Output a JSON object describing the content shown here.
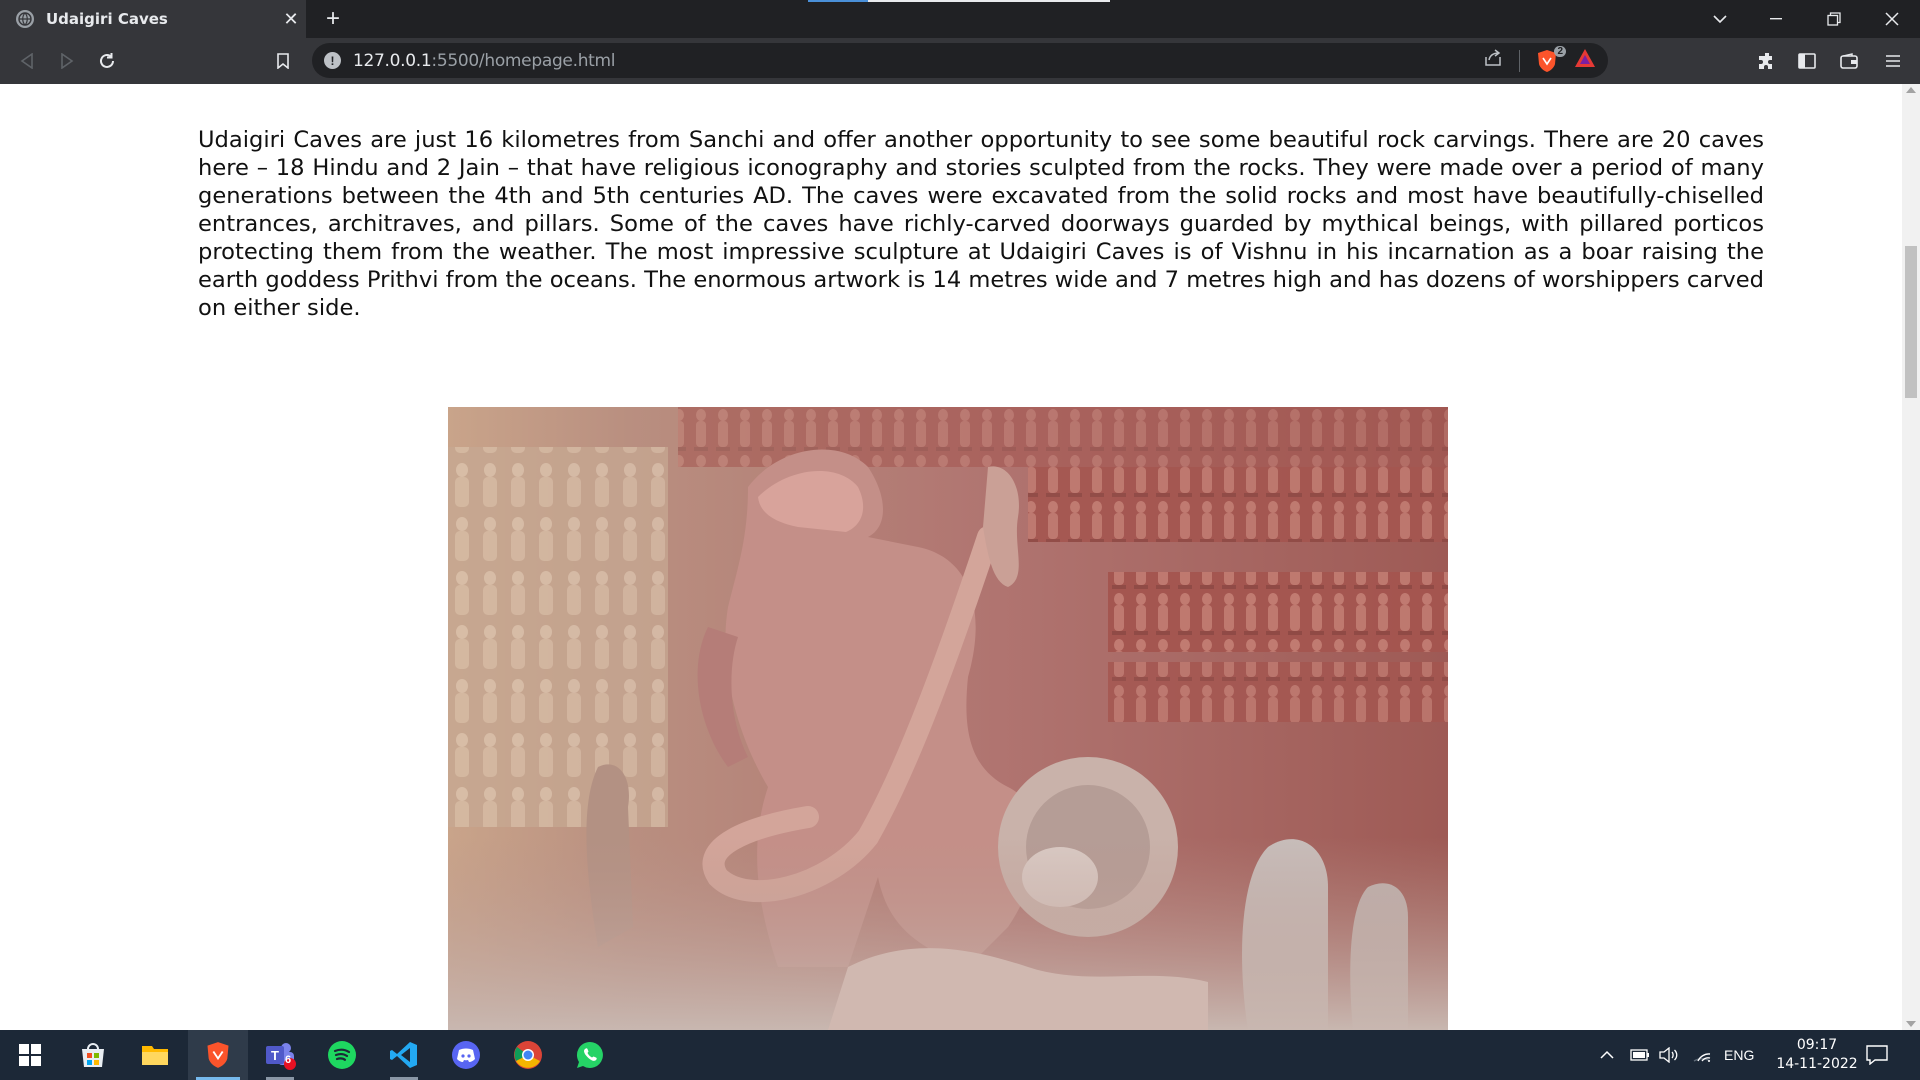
{
  "browser": {
    "tab_title": "Udaigiri Caves",
    "tab_close": "✕",
    "new_tab": "+",
    "url_host": "127.0.0.1",
    "url_path": ":5500/homepage.html",
    "shield_count": "2"
  },
  "article": {
    "paragraph": "Udaigiri Caves are just 16 kilometres from Sanchi and offer another opportunity to see some beautiful rock carvings. There are 20 caves here – 18 Hindu and 2 Jain – that have religious iconography and stories sculpted from the rocks. They were made over a period of many generations between the 4th and 5th centuries AD. The caves were excavated from the solid rocks and most have beautifully-chiselled entrances, architraves, and pillars. Some of the caves have richly-carved doorways guarded by mythical beings, with pillared porticos protecting them from the weather. The most impressive sculpture at Udaigiri Caves is of Vishnu in his incarnation as a boar raising the earth goddess Prithvi from the oceans. The enormous artwork is 14 metres wide and 7 metres high and has dozens of worshippers carved on either side."
  },
  "taskbar": {
    "teams_badge": "6",
    "language": "ENG",
    "time": "09:17",
    "date": "14-11-2022"
  },
  "colors": {
    "chrome_dark": "#202124",
    "chrome_toolbar": "#35363a",
    "taskbar": "#1c2837",
    "brave_orange": "#fb542b",
    "spotify_green": "#1ed760",
    "vscode_blue": "#23a9f2",
    "discord_purple": "#5865f2",
    "whatsapp_green": "#25d366"
  }
}
